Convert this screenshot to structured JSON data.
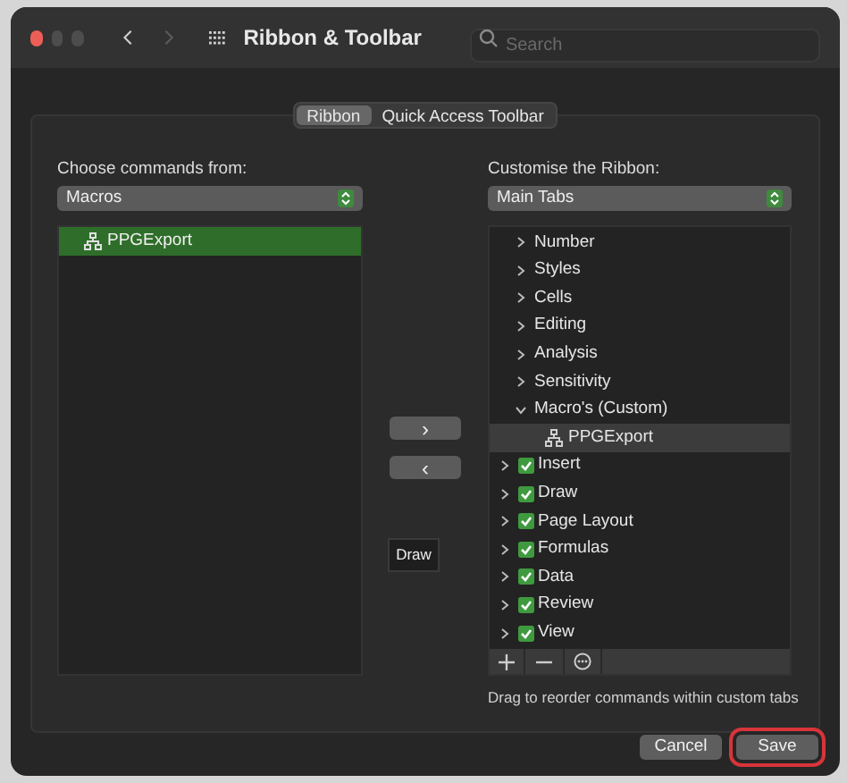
{
  "window": {
    "title": "Ribbon & Toolbar"
  },
  "search": {
    "placeholder": "Search"
  },
  "segments": [
    {
      "label": "Ribbon",
      "selected": true
    },
    {
      "label": "Quick Access Toolbar",
      "selected": false
    }
  ],
  "left": {
    "label": "Choose commands from:",
    "dropdown": "Macros",
    "items": [
      {
        "label": "PPGExport",
        "selected": true
      }
    ]
  },
  "move_buttons": [
    "›",
    "‹"
  ],
  "tooltip": "Draw",
  "right": {
    "label": "Customise the Ribbon:",
    "dropdown": "Main Tabs",
    "group_rows": [
      {
        "label": "Number",
        "expanded": false,
        "selected": false
      },
      {
        "label": "Styles",
        "expanded": false,
        "selected": false
      },
      {
        "label": "Cells",
        "expanded": false,
        "selected": false
      },
      {
        "label": "Editing",
        "expanded": false,
        "selected": false
      },
      {
        "label": "Analysis",
        "expanded": false,
        "selected": false
      },
      {
        "label": "Sensitivity",
        "expanded": false,
        "selected": false
      },
      {
        "label": "Macro's (Custom)",
        "expanded": true,
        "selected": false,
        "children": [
          {
            "label": "PPGExport",
            "selected": true
          }
        ]
      }
    ],
    "tab_rows": [
      {
        "label": "Insert",
        "checked": true,
        "expanded": false,
        "selected": false
      },
      {
        "label": "Draw",
        "checked": true,
        "expanded": false,
        "selected": false
      },
      {
        "label": "Page Layout",
        "checked": true,
        "expanded": false,
        "selected": false
      },
      {
        "label": "Formulas",
        "checked": true,
        "expanded": false,
        "selected": false
      },
      {
        "label": "Data",
        "checked": true,
        "expanded": false,
        "selected": false
      },
      {
        "label": "Review",
        "checked": true,
        "expanded": false,
        "selected": false
      },
      {
        "label": "View",
        "checked": true,
        "expanded": false,
        "selected": false
      }
    ],
    "hint": "Drag to reorder commands within custom tabs"
  },
  "buttons": [
    {
      "label": "Cancel",
      "kind": "secondary"
    },
    {
      "label": "Save",
      "kind": "default"
    }
  ]
}
